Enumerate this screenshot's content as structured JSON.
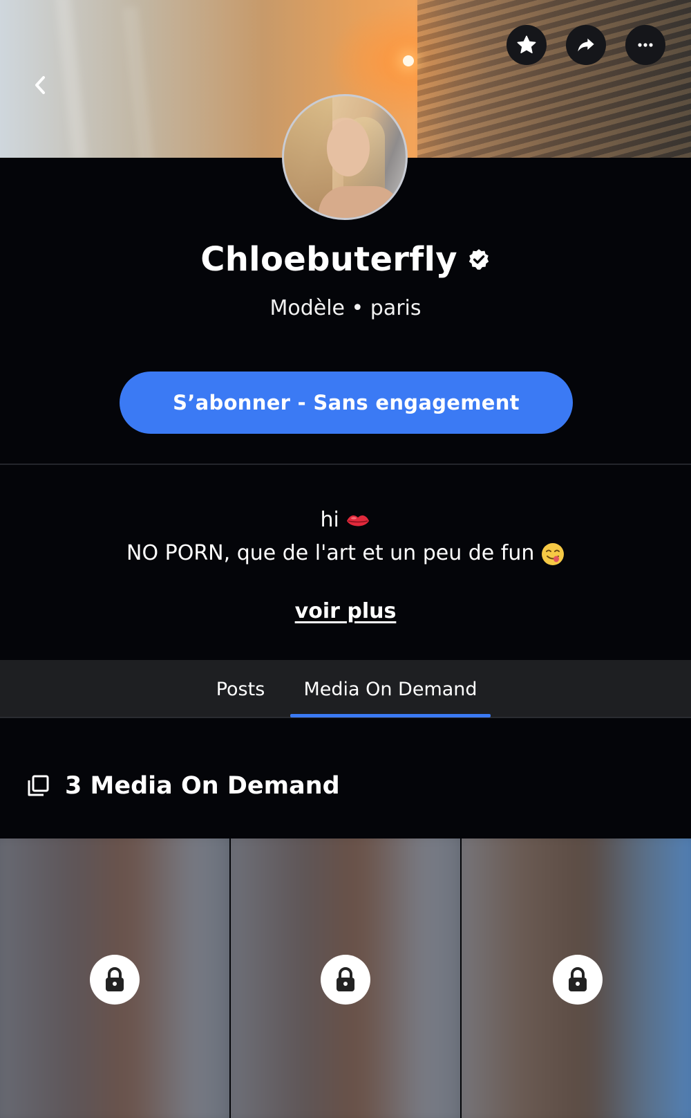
{
  "header": {
    "back_icon": "chevron-left-icon",
    "actions": [
      {
        "icon": "star-icon"
      },
      {
        "icon": "share-icon"
      },
      {
        "icon": "more-icon"
      }
    ]
  },
  "profile": {
    "name": "Chloebuterfly",
    "verified_icon": "verified-badge-icon",
    "subtitle": "Modèle • paris",
    "subscribe_label": "S’abonner - Sans engagement",
    "accent_color": "#3b7af4"
  },
  "bio": {
    "line1": "hi",
    "line1_emoji": "kiss-lips-emoji",
    "line2": "NO PORN, que de l'art et un peu de fun",
    "line2_emoji": "yum-face-emoji",
    "see_more": "voir plus"
  },
  "tabs": [
    {
      "label": "Posts",
      "active": false
    },
    {
      "label": "Media On Demand",
      "active": true
    }
  ],
  "media_section": {
    "icon": "media-stack-icon",
    "title": "3 Media On Demand",
    "items": [
      {
        "locked": true,
        "icon": "lock-icon"
      },
      {
        "locked": true,
        "icon": "lock-icon"
      },
      {
        "locked": true,
        "icon": "lock-icon"
      }
    ]
  }
}
